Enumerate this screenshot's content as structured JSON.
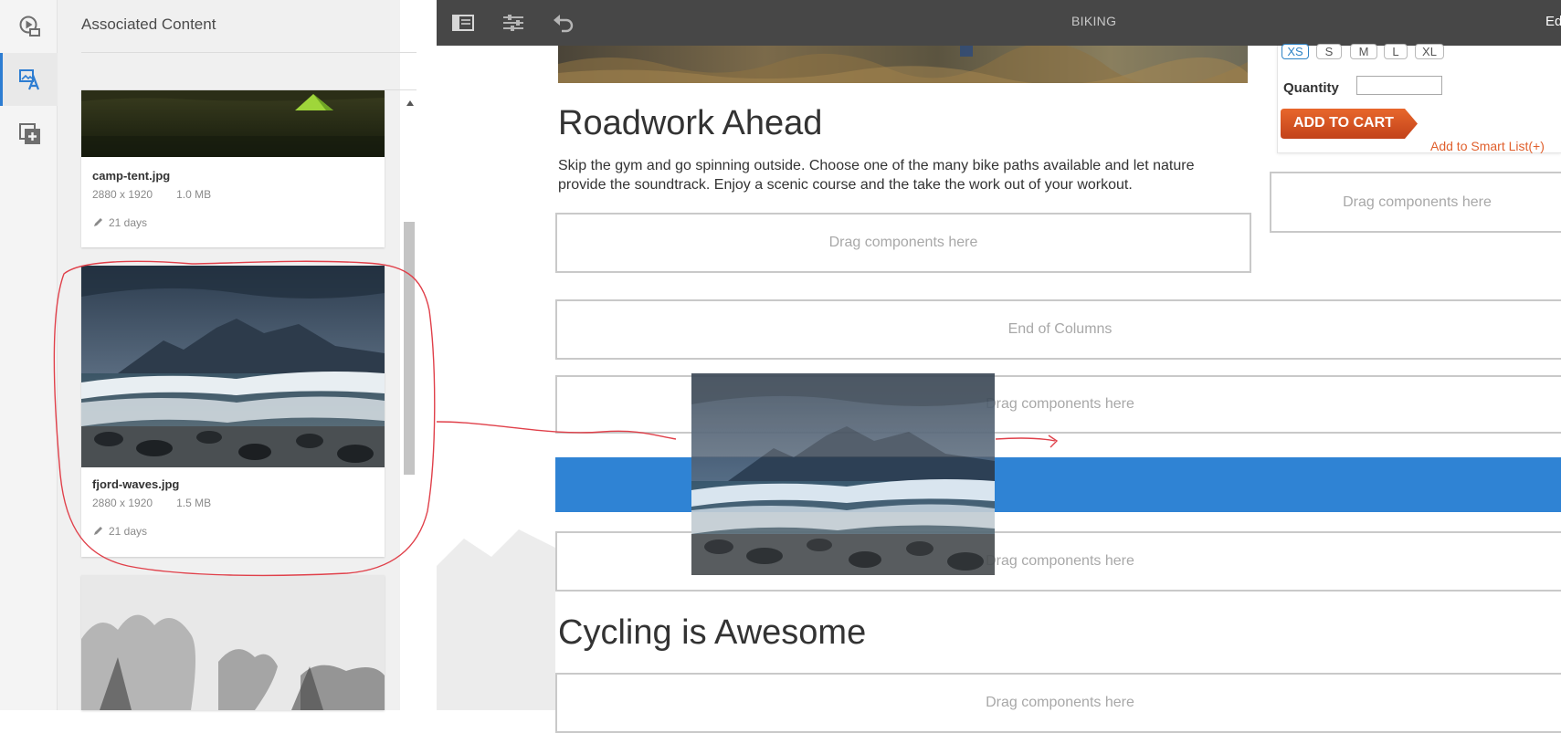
{
  "panel": {
    "title": "Associated Content",
    "assets": [
      {
        "name": "camp-tent.jpg",
        "dimensions": "2880 x 1920",
        "size": "1.0 MB",
        "modified": "21 days"
      },
      {
        "name": "fjord-waves.jpg",
        "dimensions": "2880 x 1920",
        "size": "1.5 MB",
        "modified": "21 days"
      }
    ]
  },
  "rail": {
    "icons": [
      "media-play-icon",
      "content-finder-icon",
      "add-component-icon"
    ],
    "active_index": 1
  },
  "toolbar": {
    "icons": [
      "toggle-side-panel-icon",
      "page-properties-icon",
      "undo-icon"
    ],
    "page_name": "BIKING",
    "mode_label": "Edi"
  },
  "product": {
    "sizes": [
      "XS",
      "S",
      "M",
      "L",
      "XL"
    ],
    "selected_size": "XS",
    "quantity_label": "Quantity",
    "quantity_value": "",
    "add_to_cart": "ADD TO CART",
    "smart_list_link": "Add to Smart List(+)"
  },
  "content": {
    "heading1": "Roadwork Ahead",
    "body": "Skip the gym and go spinning outside. Choose one of the many bike paths available and let nature provide the soundtrack. Enjoy a scenic course and the take the work out of your workout.",
    "dropzone_label": "Drag components here",
    "end_of_columns": "End of Columns",
    "heading2": "Cycling is Awesome"
  },
  "colors": {
    "accent": "#2f83d4",
    "toolbar": "#474747",
    "cart": "#d9531e",
    "annotation": "#e0404a"
  }
}
